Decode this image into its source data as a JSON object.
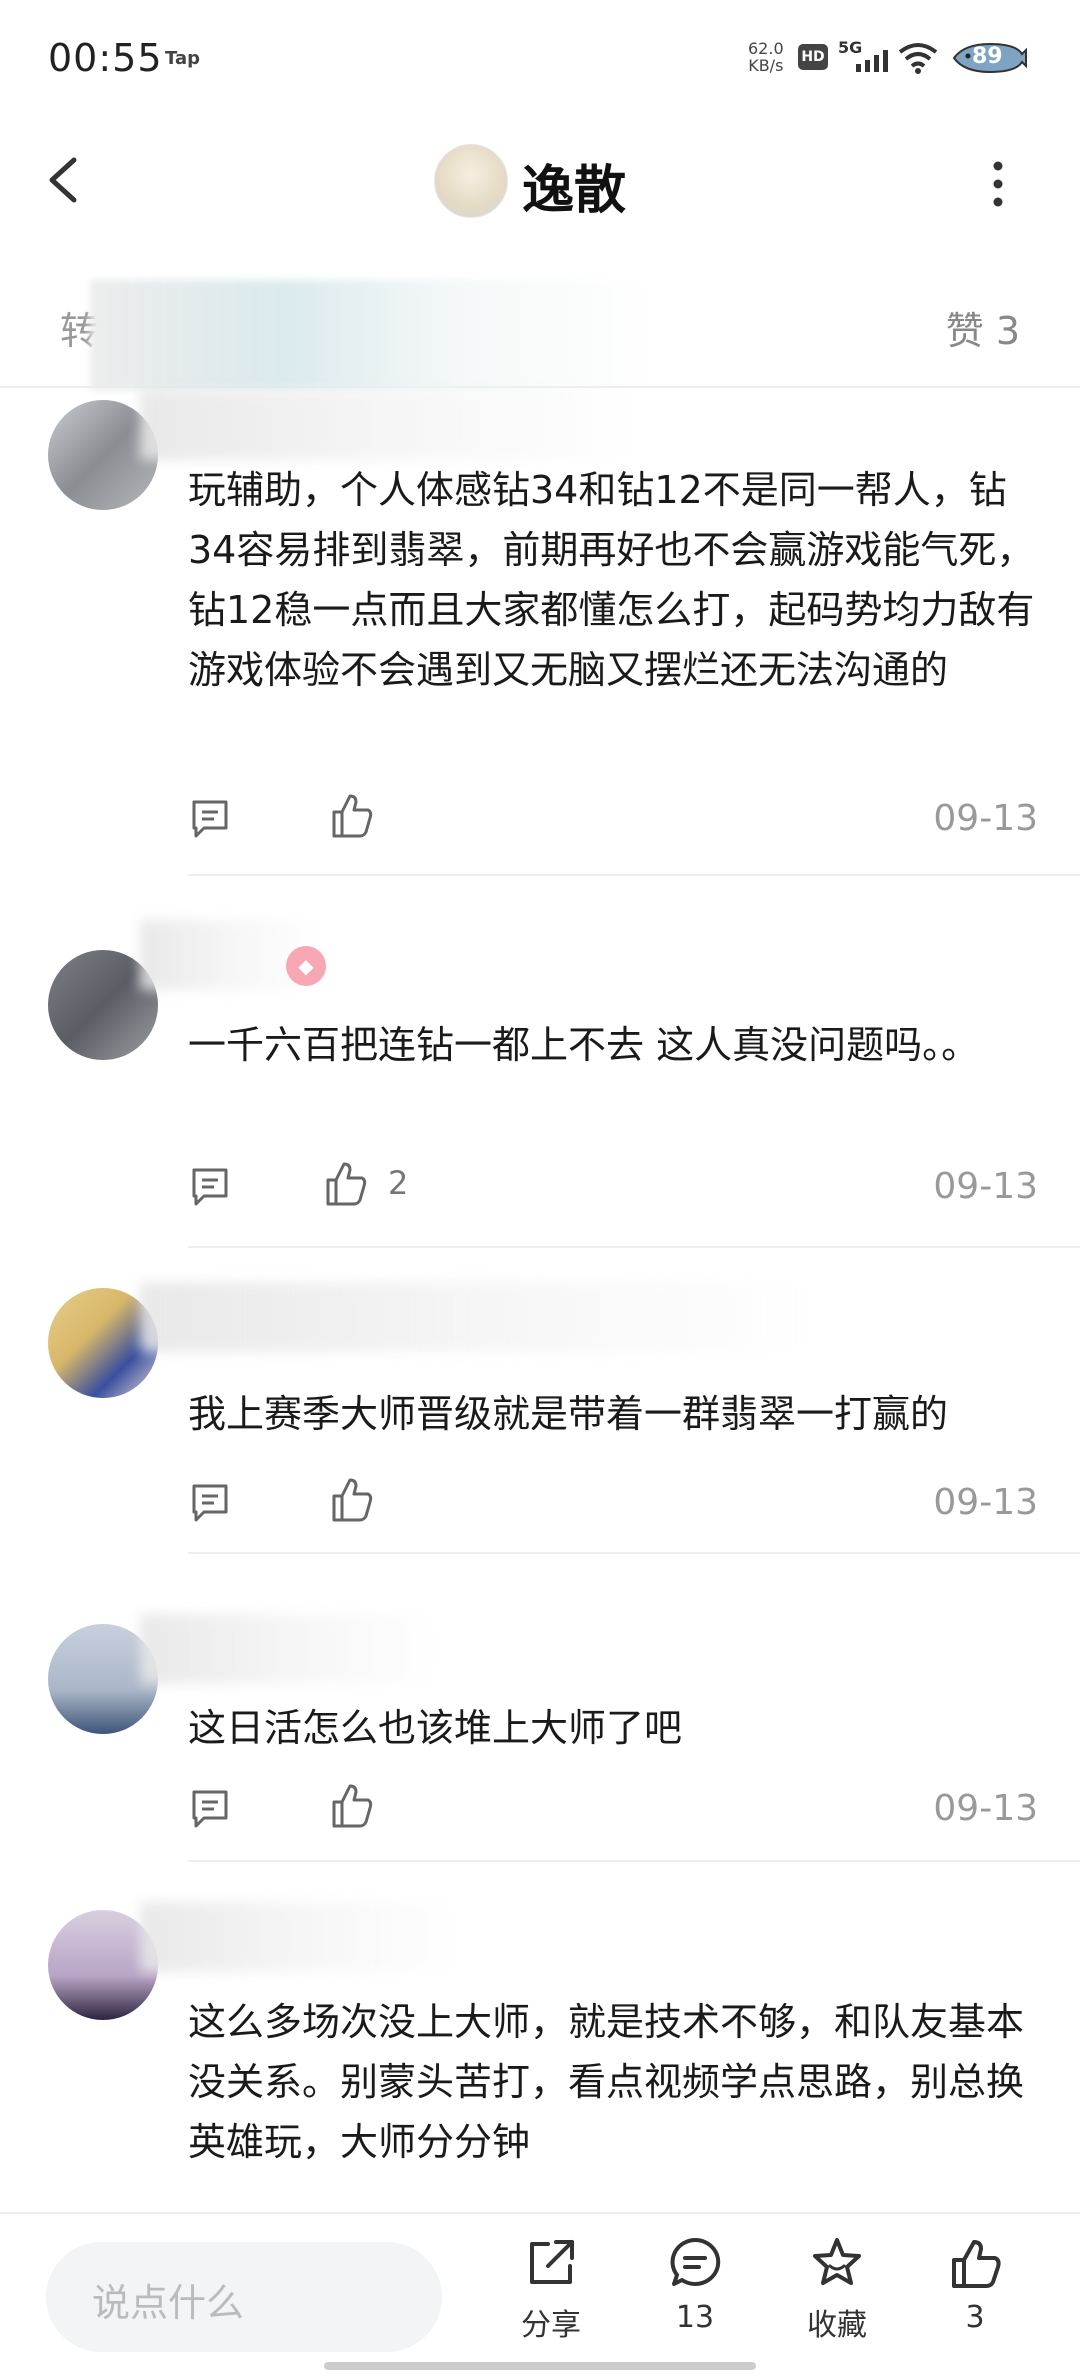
{
  "status_bar": {
    "time": "00:55",
    "carrier_label": "Tap",
    "net_speed_value": "62.0",
    "net_speed_unit": "KB/s",
    "hd_label": "HD",
    "network": "5G",
    "battery": "89"
  },
  "header": {
    "title": "逸散",
    "back_icon": "chevron-left-icon",
    "more_icon": "more-vertical-icon"
  },
  "tab_row": {
    "left_label": "转",
    "likes_label": "赞 3"
  },
  "comments": [
    {
      "text": "玩辅助，个人体感钻34和钻12不是同一帮人，钻34容易排到翡翠，前期再好也不会赢游戏能气死，钻12稳一点而且大家都懂怎么打，起码势均力敌有游戏体验不会遇到又无脑又摆烂还无法沟通的",
      "likes": "",
      "date": "09-13"
    },
    {
      "text": "一千六百把连钻一都上不去 这人真没问题吗。。",
      "likes": "2",
      "date": "09-13"
    },
    {
      "text": "我上赛季大师晋级就是带着一群翡翠一打赢的",
      "likes": "",
      "date": "09-13"
    },
    {
      "text": "这日活怎么也该堆上大师了吧",
      "likes": "",
      "date": "09-13"
    },
    {
      "text": "这么多场次没上大师，就是技术不够，和队友基本没关系。别蒙头苦打，看点视频学点思路，别总换英雄玩，大师分分钟",
      "likes": "",
      "date": ""
    }
  ],
  "bottom_bar": {
    "input_placeholder": "说点什么",
    "share_label": "分享",
    "comment_count": "13",
    "collect_label": "收藏",
    "like_count": "3"
  },
  "colors": {
    "text": "#1a1a1a",
    "muted": "#999999",
    "divider": "#eeeeee",
    "input_bg": "#f3f4f6"
  }
}
